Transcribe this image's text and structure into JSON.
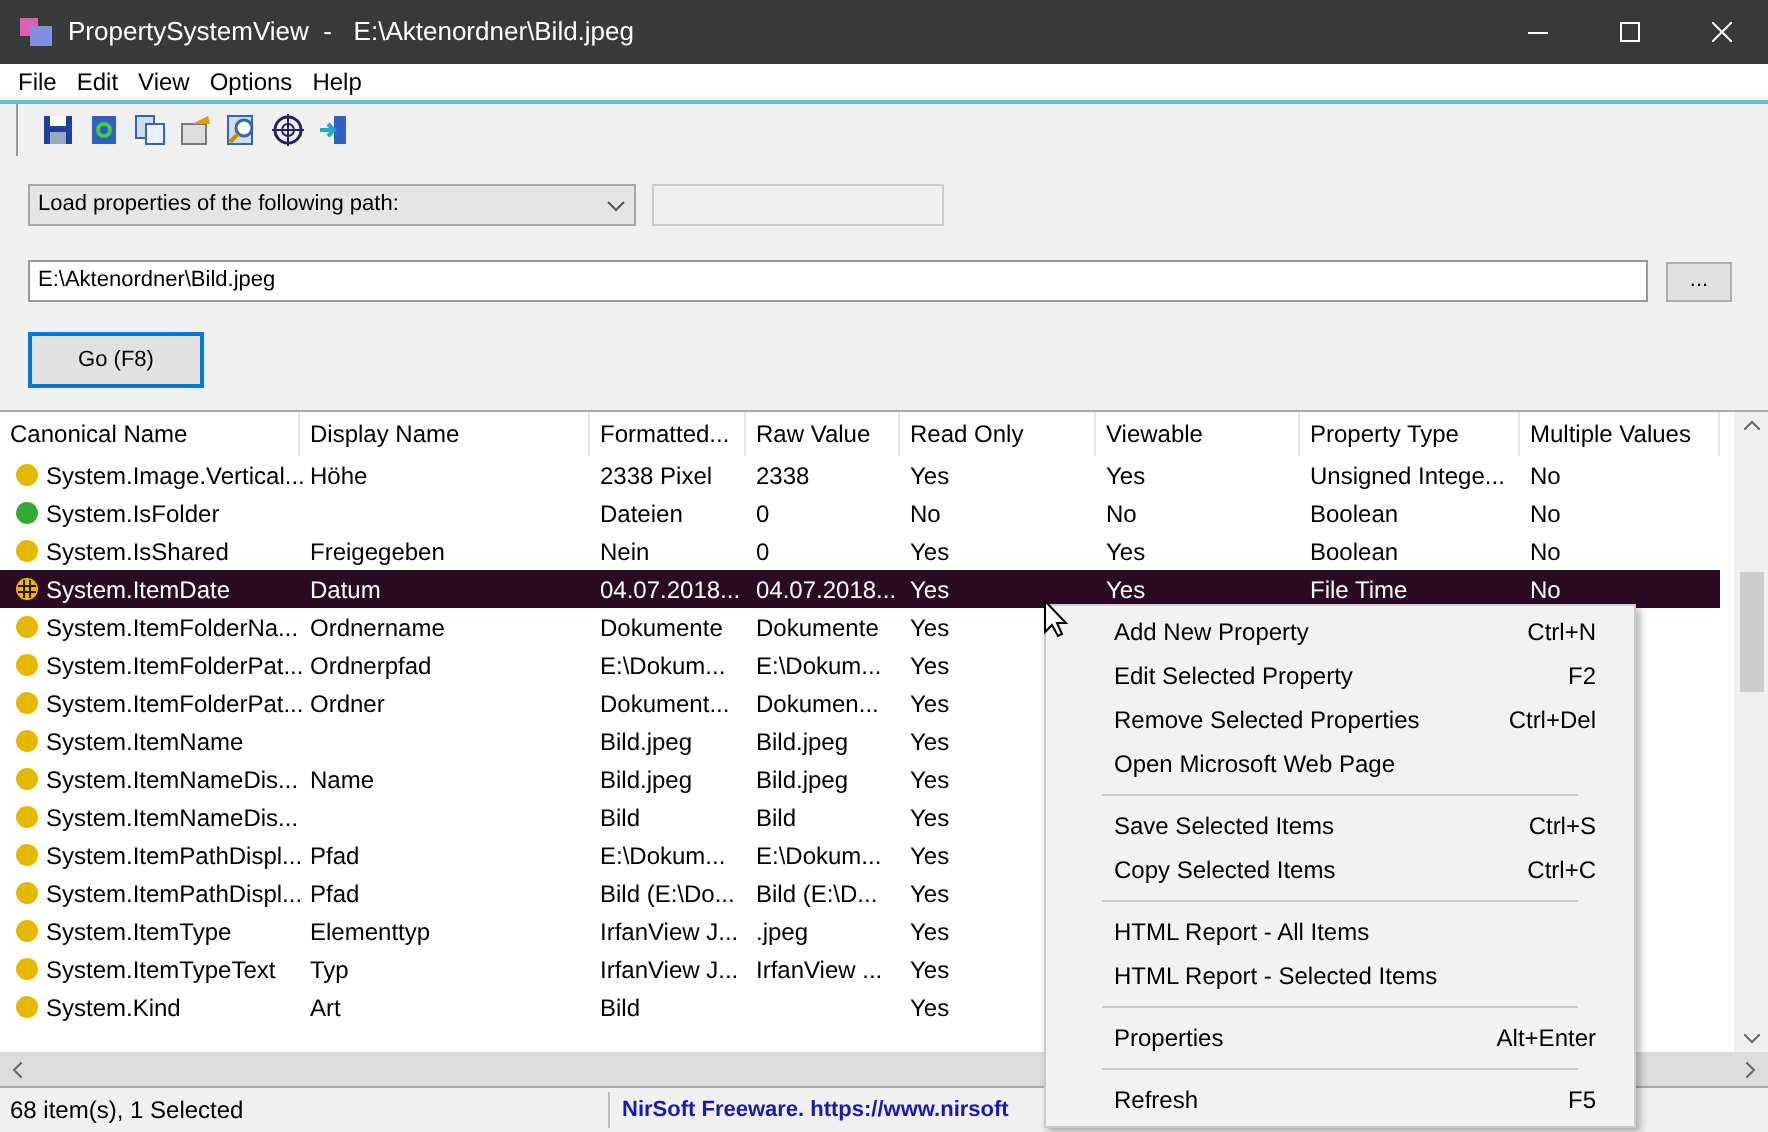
{
  "window": {
    "title": "PropertySystemView  -   E:\\Aktenordner\\Bild.jpeg"
  },
  "menu_bar": [
    "File",
    "Edit",
    "View",
    "Options",
    "Help"
  ],
  "source": {
    "mode": "Load properties of the following path:",
    "path": "E:\\Aktenordner\\Bild.jpeg",
    "browse": "...",
    "go": "Go (F8)"
  },
  "table": {
    "columns": [
      "Canonical Name",
      "Display Name",
      "Formatted...",
      "Raw Value",
      "Read Only",
      "Viewable",
      "Property Type",
      "Multiple Values"
    ],
    "rows": [
      {
        "color": "#e6b800",
        "selected": false,
        "cells": [
          "System.Image.Vertical...",
          "Höhe",
          "2338 Pixel",
          "2338",
          "Yes",
          "Yes",
          "Unsigned Intege...",
          "No"
        ]
      },
      {
        "color": "#33aa33",
        "selected": false,
        "cells": [
          "System.IsFolder",
          "",
          "Dateien",
          "0",
          "No",
          "No",
          "Boolean",
          "No"
        ]
      },
      {
        "color": "#e6b800",
        "selected": false,
        "cells": [
          "System.IsShared",
          "Freigegeben",
          "Nein",
          "0",
          "Yes",
          "Yes",
          "Boolean",
          "No"
        ]
      },
      {
        "color": "#e6b800",
        "selected": true,
        "cells": [
          "System.ItemDate",
          "Datum",
          "04.07.2018...",
          "04.07.2018...",
          "Yes",
          "Yes",
          "File Time",
          "No"
        ]
      },
      {
        "color": "#e6b800",
        "selected": false,
        "cells": [
          "System.ItemFolderNa...",
          "Ordnername",
          "Dokumente",
          "Dokumente",
          "Yes"
        ]
      },
      {
        "color": "#e6b800",
        "selected": false,
        "cells": [
          "System.ItemFolderPat...",
          "Ordnerpfad",
          "E:\\Dokum...",
          "E:\\Dokum...",
          "Yes"
        ]
      },
      {
        "color": "#e6b800",
        "selected": false,
        "cells": [
          "System.ItemFolderPat...",
          "Ordner",
          "Dokument...",
          "Dokumen...",
          "Yes"
        ]
      },
      {
        "color": "#e6b800",
        "selected": false,
        "cells": [
          "System.ItemName",
          "",
          "Bild.jpeg",
          "Bild.jpeg",
          "Yes"
        ]
      },
      {
        "color": "#e6b800",
        "selected": false,
        "cells": [
          "System.ItemNameDis...",
          "Name",
          "Bild.jpeg",
          "Bild.jpeg",
          "Yes"
        ]
      },
      {
        "color": "#e6b800",
        "selected": false,
        "cells": [
          "System.ItemNameDis...",
          "",
          "Bild",
          "Bild",
          "Yes"
        ]
      },
      {
        "color": "#e6b800",
        "selected": false,
        "cells": [
          "System.ItemPathDispl...",
          "Pfad",
          "E:\\Dokum...",
          "E:\\Dokum...",
          "Yes"
        ]
      },
      {
        "color": "#e6b800",
        "selected": false,
        "cells": [
          "System.ItemPathDispl...",
          "Pfad",
          "Bild (E:\\Do...",
          "Bild (E:\\D...",
          "Yes"
        ]
      },
      {
        "color": "#e6b800",
        "selected": false,
        "cells": [
          "System.ItemType",
          "Elementtyp",
          "IrfanView J...",
          ".jpeg",
          "Yes"
        ]
      },
      {
        "color": "#e6b800",
        "selected": false,
        "cells": [
          "System.ItemTypeText",
          "Typ",
          "IrfanView J...",
          "IrfanView ...",
          "Yes"
        ]
      },
      {
        "color": "#e6b800",
        "selected": false,
        "cells": [
          "System.Kind",
          "Art",
          "Bild",
          "",
          "Yes"
        ]
      }
    ]
  },
  "context_menu": [
    {
      "kind": "item",
      "label": "Add New Property",
      "shortcut": "Ctrl+N"
    },
    {
      "kind": "item",
      "label": "Edit Selected Property",
      "shortcut": "F2"
    },
    {
      "kind": "item",
      "label": "Remove Selected Properties",
      "shortcut": "Ctrl+Del"
    },
    {
      "kind": "item",
      "label": "Open Microsoft Web Page"
    },
    {
      "kind": "separator"
    },
    {
      "kind": "item",
      "label": "Save Selected Items",
      "shortcut": "Ctrl+S"
    },
    {
      "kind": "item",
      "label": "Copy Selected Items",
      "shortcut": "Ctrl+C"
    },
    {
      "kind": "separator"
    },
    {
      "kind": "item",
      "label": "HTML Report - All Items"
    },
    {
      "kind": "item",
      "label": "HTML Report - Selected Items"
    },
    {
      "kind": "separator"
    },
    {
      "kind": "item",
      "label": "Properties",
      "shortcut": "Alt+Enter"
    },
    {
      "kind": "separator"
    },
    {
      "kind": "item",
      "label": "Refresh",
      "shortcut": "F5"
    }
  ],
  "status_bar": {
    "count": "68 item(s), 1 Selected",
    "link": "NirSoft Freeware. https://www.nirsoft"
  }
}
